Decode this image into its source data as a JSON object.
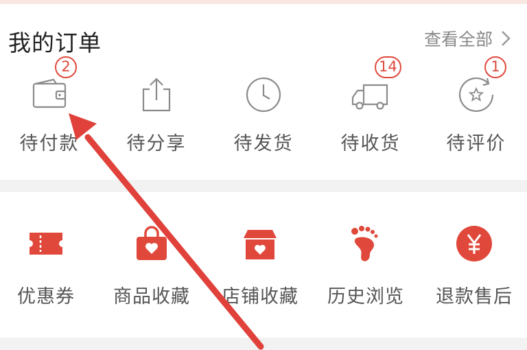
{
  "colors": {
    "accent": "#e0483b",
    "text": "#555555",
    "title": "#222222",
    "muted": "#888888",
    "annotation_arrow": "#e0413a"
  },
  "orders": {
    "title": "我的订单",
    "view_all": "查看全部",
    "items": [
      {
        "label": "待付款",
        "icon": "wallet-icon",
        "badge": "2"
      },
      {
        "label": "待分享",
        "icon": "share-icon",
        "badge": null
      },
      {
        "label": "待发货",
        "icon": "clock-icon",
        "badge": null
      },
      {
        "label": "待收货",
        "icon": "truck-icon",
        "badge": "14"
      },
      {
        "label": "待评价",
        "icon": "review-icon",
        "badge": "1"
      }
    ]
  },
  "tools": {
    "items": [
      {
        "label": "优惠券",
        "icon": "coupon-icon"
      },
      {
        "label": "商品收藏",
        "icon": "bag-heart-icon"
      },
      {
        "label": "店铺收藏",
        "icon": "store-heart-icon"
      },
      {
        "label": "历史浏览",
        "icon": "footprint-icon"
      },
      {
        "label": "退款售后",
        "icon": "yen-icon"
      }
    ]
  }
}
